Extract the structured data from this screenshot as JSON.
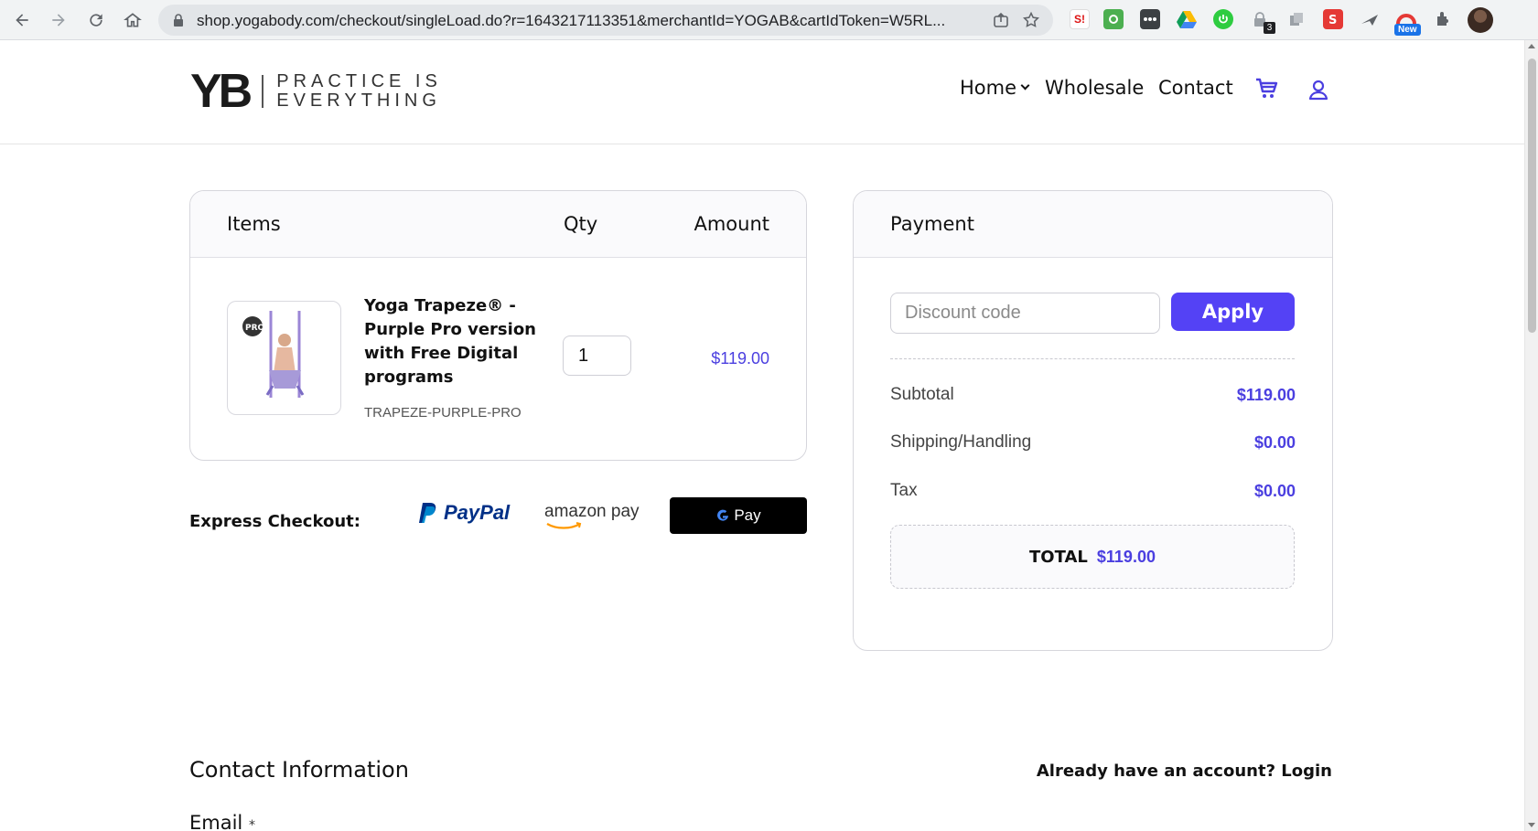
{
  "browser": {
    "url": "shop.yogabody.com/checkout/singleLoad.do?r=1643217113351&merchantId=YOGAB&cartIdToken=W5RL...",
    "extensions": {
      "ext_s_label": "S!",
      "badge_count": "3",
      "badge_new": "New"
    }
  },
  "header": {
    "logo_mark": "YB",
    "logo_tagline_1": "PRACTICE IS",
    "logo_tagline_2": "EVERYTHING",
    "nav": {
      "home": "Home",
      "wholesale": "Wholesale",
      "contact": "Contact"
    }
  },
  "cart": {
    "columns": {
      "items": "Items",
      "qty": "Qty",
      "amount": "Amount"
    },
    "items": [
      {
        "name": "Yoga Trapeze® - Purple Pro version with Free Digital programs",
        "sku": "TRAPEZE-PURPLE-PRO",
        "qty": "1",
        "amount": "$119.00",
        "thumb_badge": "PRO"
      }
    ]
  },
  "express": {
    "label": "Express Checkout:",
    "paypal": "PayPal",
    "amazon": "amazon pay",
    "gpay": "Pay"
  },
  "payment": {
    "title": "Payment",
    "discount_placeholder": "Discount code",
    "apply_label": "Apply",
    "subtotal_label": "Subtotal",
    "subtotal_value": "$119.00",
    "shipping_label": "Shipping/Handling",
    "shipping_value": "$0.00",
    "tax_label": "Tax",
    "tax_value": "$0.00",
    "total_label": "TOTAL",
    "total_value": "$119.00"
  },
  "contact": {
    "title": "Contact Information",
    "login_link": "Already have an account? Login",
    "email_label": "Email",
    "required_mark": "*"
  },
  "colors": {
    "accent": "#5442f5",
    "price": "#4b3fe0"
  }
}
